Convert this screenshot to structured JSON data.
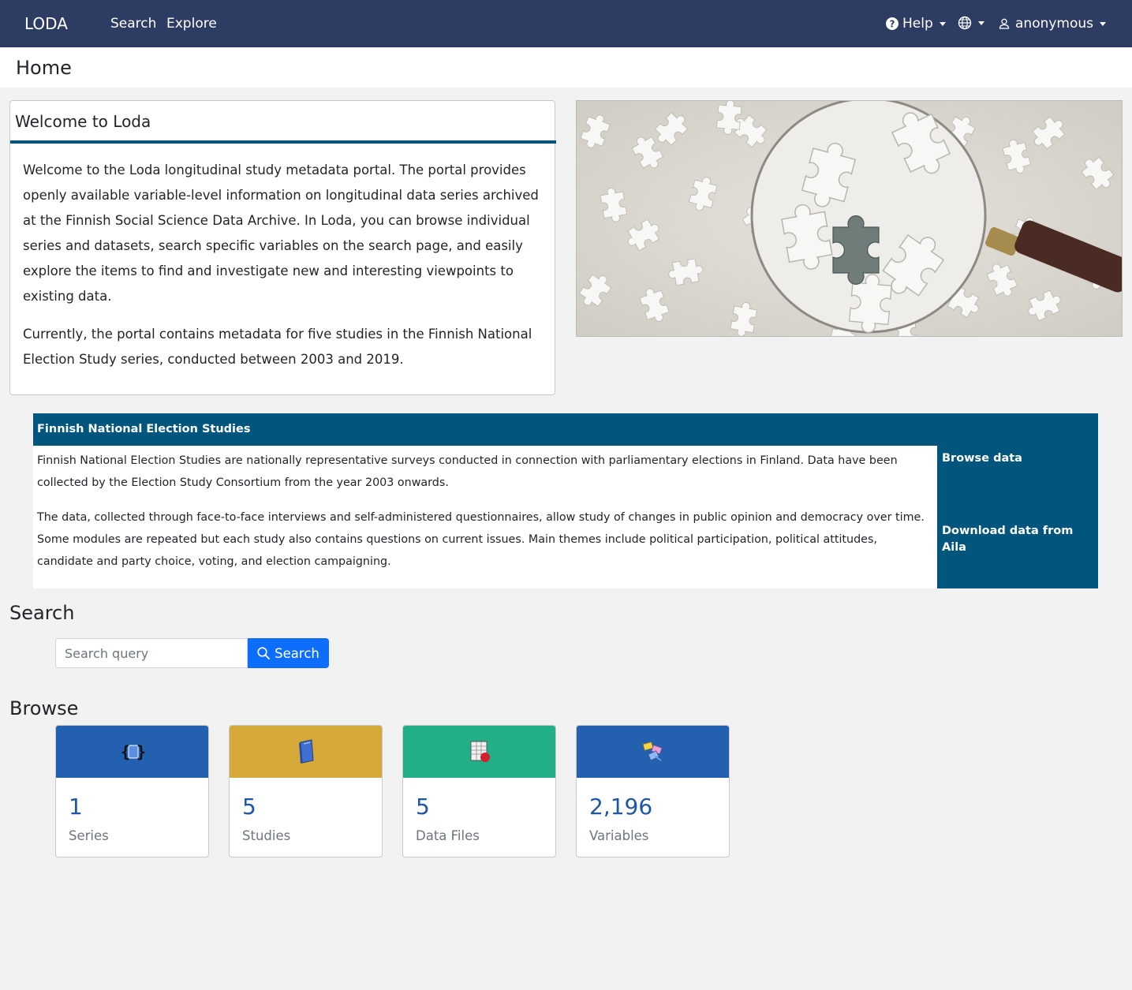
{
  "nav": {
    "brand": "LODA",
    "search": "Search",
    "explore": "Explore",
    "help": "Help",
    "user": "anonymous"
  },
  "page": {
    "title": "Home"
  },
  "welcome": {
    "title": "Welcome to Loda",
    "paragraph1": "Welcome to the Loda longitudinal study metadata portal. The portal provides openly available variable-level information on longitudinal data series archived at the Finnish Social Science Data Archive. In Loda, you can browse individual series and datasets, search specific variables on the search page, and easily explore the items to find and investigate new and interesting viewpoints to existing data.",
    "paragraph2": "Currently, the portal contains metadata for five studies in the Finnish National Election Study series, conducted between 2003 and 2019."
  },
  "series": {
    "title": "Finnish National Election Studies",
    "paragraph1": "Finnish National Election Studies are nationally representative surveys conducted in connection with parliamentary elections in Finland. Data have been collected by the Election Study Consortium from the year 2003 onwards.",
    "paragraph2": "The data, collected through face-to-face interviews and self-administered questionnaires, allow study of changes in public opinion and democracy over time. Some modules are repeated but each study also contains questions on current issues. Main themes include political participation, political attitudes, candidate and party choice, voting, and election campaigning.",
    "browse_link": "Browse data",
    "download_link": "Download data from Aila"
  },
  "search": {
    "title": "Search",
    "placeholder": "Search query",
    "button": "Search"
  },
  "browse": {
    "title": "Browse",
    "cards": [
      {
        "count": "1",
        "label": "Series",
        "color": "#2460b0",
        "icon": "series-icon"
      },
      {
        "count": "5",
        "label": "Studies",
        "color": "#d4a937",
        "icon": "studies-icon"
      },
      {
        "count": "5",
        "label": "Data Files",
        "color": "#22ae87",
        "icon": "data-files-icon"
      },
      {
        "count": "2,196",
        "label": "Variables",
        "color": "#2460b0",
        "icon": "variables-icon"
      }
    ]
  },
  "colors": {
    "navbar": "#2c3c62",
    "accent": "#02567e",
    "primary_button": "#0d6efd"
  }
}
